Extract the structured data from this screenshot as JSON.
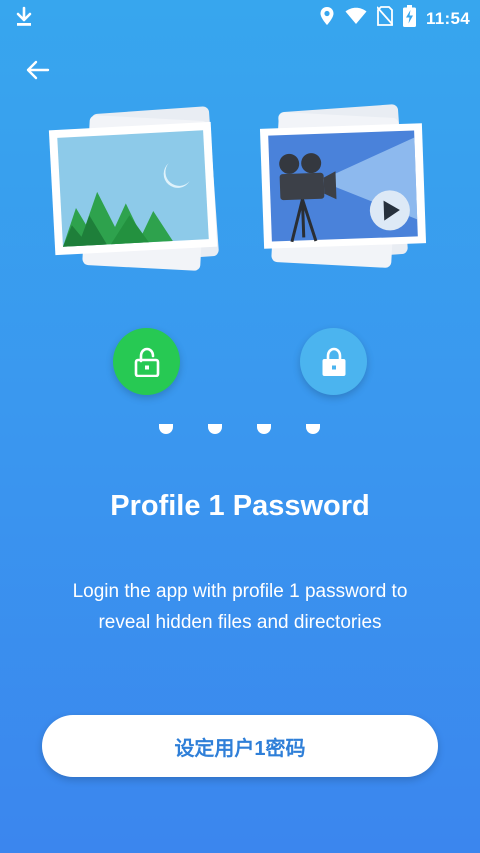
{
  "status_bar": {
    "time": "11:54"
  },
  "illustration": {
    "left_card": "landscape-photo",
    "right_card": "video-camera"
  },
  "pager": {
    "count": 4
  },
  "content": {
    "title": "Profile 1 Password",
    "description": "Login the app with profile 1 password to reveal hidden files and directories"
  },
  "cta": {
    "label": "设定用户1密码"
  },
  "colors": {
    "bg_top": "#37a6ee",
    "bg_bottom": "#3b86ee",
    "unlock_green": "#27c953",
    "lock_blue": "#4bb4ef",
    "button_text": "#2f7fd8"
  }
}
